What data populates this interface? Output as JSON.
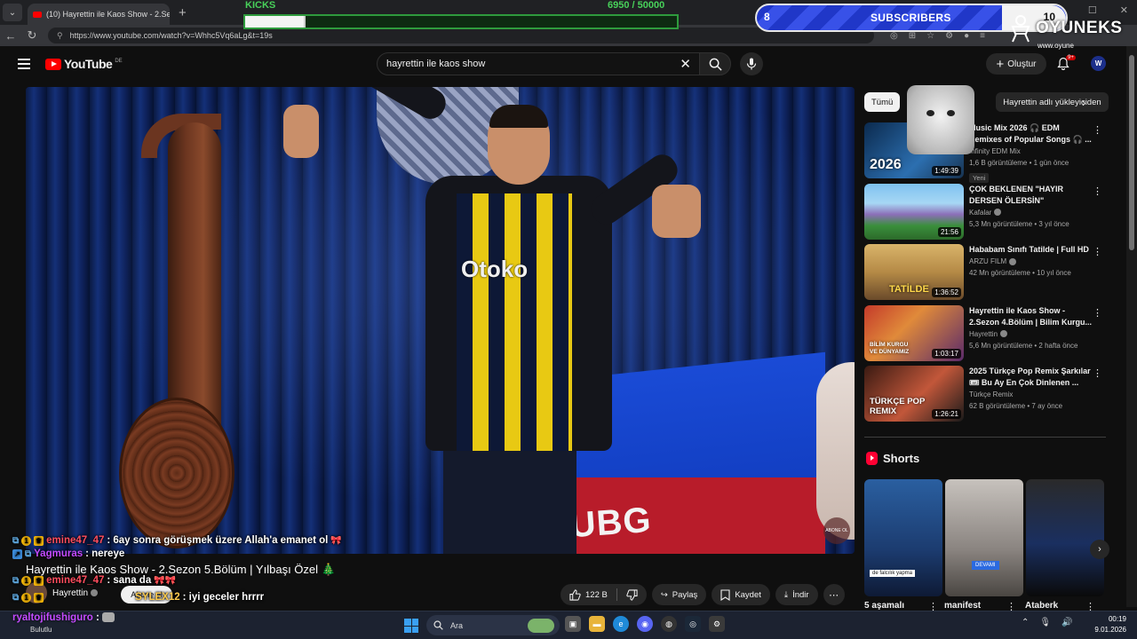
{
  "browser": {
    "tab_title": "(10) Hayrettin ile Kaos Show - 2.Se",
    "url": "https://www.youtube.com/watch?v=Whhc5Vq6aLg&t=19s"
  },
  "youtube": {
    "logo_text": "YouTube",
    "logo_country": "DE",
    "search_value": "hayrettin ile kaos show",
    "create_label": "Oluştur",
    "notif_badge": "9+",
    "avatar_letter": "W"
  },
  "overlay": {
    "kicks_label": "KICKS",
    "kicks_count": "6950  / 50000",
    "kicks_progress": 0.139,
    "subs_left": "8",
    "subs_label": "SUBSCRIBERS",
    "subs_right": "10",
    "brand": "OYUNEKS",
    "brand_url": "www.oyune"
  },
  "chat": [
    {
      "user": "emine47_47",
      "msg": ": 6ay sonra görüşmek üzere Allah'a emanet ol",
      "color": "#ff4d5e"
    },
    {
      "user": "Yagmuras",
      "msg": ": nereye",
      "color": "#c44bff"
    },
    {
      "user": "emine47_47",
      "msg": ": sana da",
      "color": "#ff4d5e"
    },
    {
      "user": "SYLEX12",
      "msg": ": iyi geceler hrrrr",
      "color": "#ffcc4d"
    }
  ],
  "chat_last": {
    "user": "ryaltojifushiguro",
    "msg": ":"
  },
  "video": {
    "title": "Hayrettin ile Kaos Show - 2.Sezon 5.Bölüm | Yılbaşı Özel 🎄",
    "channel": "Hayrettin",
    "subscribe_label": "Abone ol",
    "likes": "122 B",
    "share_label": "Paylaş",
    "save_label": "Kaydet",
    "download_label": "İndir",
    "shirt_text": "Otoko",
    "watermark": "ABONE OL"
  },
  "chips": [
    "Tümü",
    "Hayrettin adlı yükleyiciden"
  ],
  "recommendations": [
    {
      "title": "Music Mix 2026 🎧 EDM Remixes of Popular Songs 🎧 ...",
      "channel": "Infinity EDM Mix",
      "meta": "1,6 B görüntüleme • 1 gün önce",
      "duration": "1:49:39",
      "badge": "Yeni",
      "thumb_text": "2026",
      "verified": false
    },
    {
      "title": "ÇOK BEKLENEN \"HAYIR DERSEN ÖLERSİN\"",
      "channel": "Kafalar",
      "meta": "5,3 Mn görüntüleme • 3 yıl önce",
      "duration": "21:56",
      "badge": "",
      "thumb_text": "",
      "verified": true
    },
    {
      "title": "Hababam Sınıfı Tatilde | Full HD",
      "channel": "ARZU FILM",
      "meta": "42 Mn görüntüleme • 10 yıl önce",
      "duration": "1:36:52",
      "badge": "",
      "thumb_text": "TATİLDE",
      "verified": true
    },
    {
      "title": "Hayrettin ile Kaos Show - 2.Sezon 4.Bölüm | Bilim Kurgu...",
      "channel": "Hayrettin",
      "meta": "5,6 Mn görüntüleme • 2 hafta önce",
      "duration": "1:03:17",
      "badge": "",
      "thumb_text": "BİLİM KURGU VE DÜNYAMIZ",
      "verified": true
    },
    {
      "title": "2025 Türkçe Pop Remix Şarkılar 🎟 Bu Ay En Çok Dinlenen ...",
      "channel": "Türkçe Remix",
      "meta": "62 B görüntüleme • 7 ay önce",
      "duration": "1:26:21",
      "badge": "",
      "thumb_text": "TÜRKÇE POP REMIX",
      "verified": false
    }
  ],
  "shorts": {
    "heading": "Shorts",
    "items": [
      {
        "title": "5 aşamalı",
        "caption": "de falcılık yapma"
      },
      {
        "title": "manifest",
        "caption": "DEVAMI"
      },
      {
        "title": "Ataberk",
        "caption": ""
      }
    ]
  },
  "taskbar": {
    "search_placeholder": "Ara",
    "weather": "Bulutlu",
    "time": "00:19",
    "date": "9.01.2026"
  },
  "colors": {
    "yt_red": "#ff0000",
    "kicks_green": "#48d15a",
    "subs_blue": "#2037c8"
  }
}
